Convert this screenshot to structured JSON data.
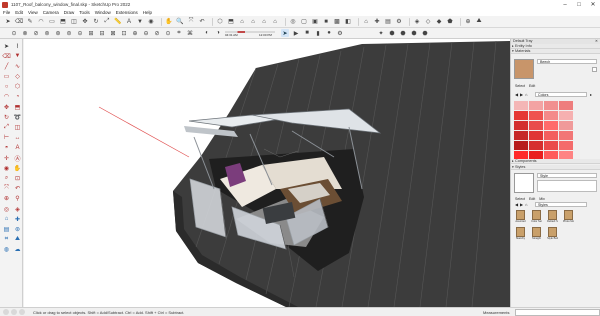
{
  "window": {
    "title": "1107_Roof_balcony_window_final.skp - SketchUp Pro 2022"
  },
  "menu": [
    "File",
    "Edit",
    "View",
    "Camera",
    "Draw",
    "Tools",
    "Window",
    "Extensions",
    "Help"
  ],
  "toolbar2": {
    "shadow_times": [
      "04:31 AM",
      "12:00 PM"
    ]
  },
  "status": {
    "message": "Click or drag to select objects. Shift = Add/Subtract. Ctrl = Add. Shift + Ctrl = Subtract.",
    "measurements_label": "Measurements"
  },
  "tray": {
    "title": "Default Tray",
    "sections": {
      "entity_info": "Entity Info",
      "materials": "Materials",
      "components": "Components",
      "styles": "Styles"
    },
    "materials": {
      "name": "Beech",
      "select_tab": "Select",
      "edit_tab": "Edit",
      "collection": "Colors",
      "swatch_color": "#c8956a",
      "colors": [
        "#f4b6b6",
        "#f3a3a3",
        "#f19090",
        "#ee7d7d",
        "#e53935",
        "#ef5350",
        "#f48a8a",
        "#f6b0b0",
        "#d32f2f",
        "#e94b4b",
        "#ff6b6b",
        "#f09a9a",
        "#c62828",
        "#e03535",
        "#f35f5f",
        "#f27676",
        "#b71c1c",
        "#d62f2f",
        "#ea4a4a",
        "#f46b6b",
        "#ff2a2a",
        "#e91e1e",
        "#ff5a5a",
        "#ff8383"
      ]
    },
    "styles": {
      "name": "Style",
      "tabs": [
        "Select",
        "Edit",
        "Mix"
      ],
      "collection": "Styles",
      "items": [
        "Assorted",
        "Color Set",
        "Default S",
        "Photo Mo",
        "Sketchy",
        "Straight",
        "Style Buil"
      ]
    }
  }
}
